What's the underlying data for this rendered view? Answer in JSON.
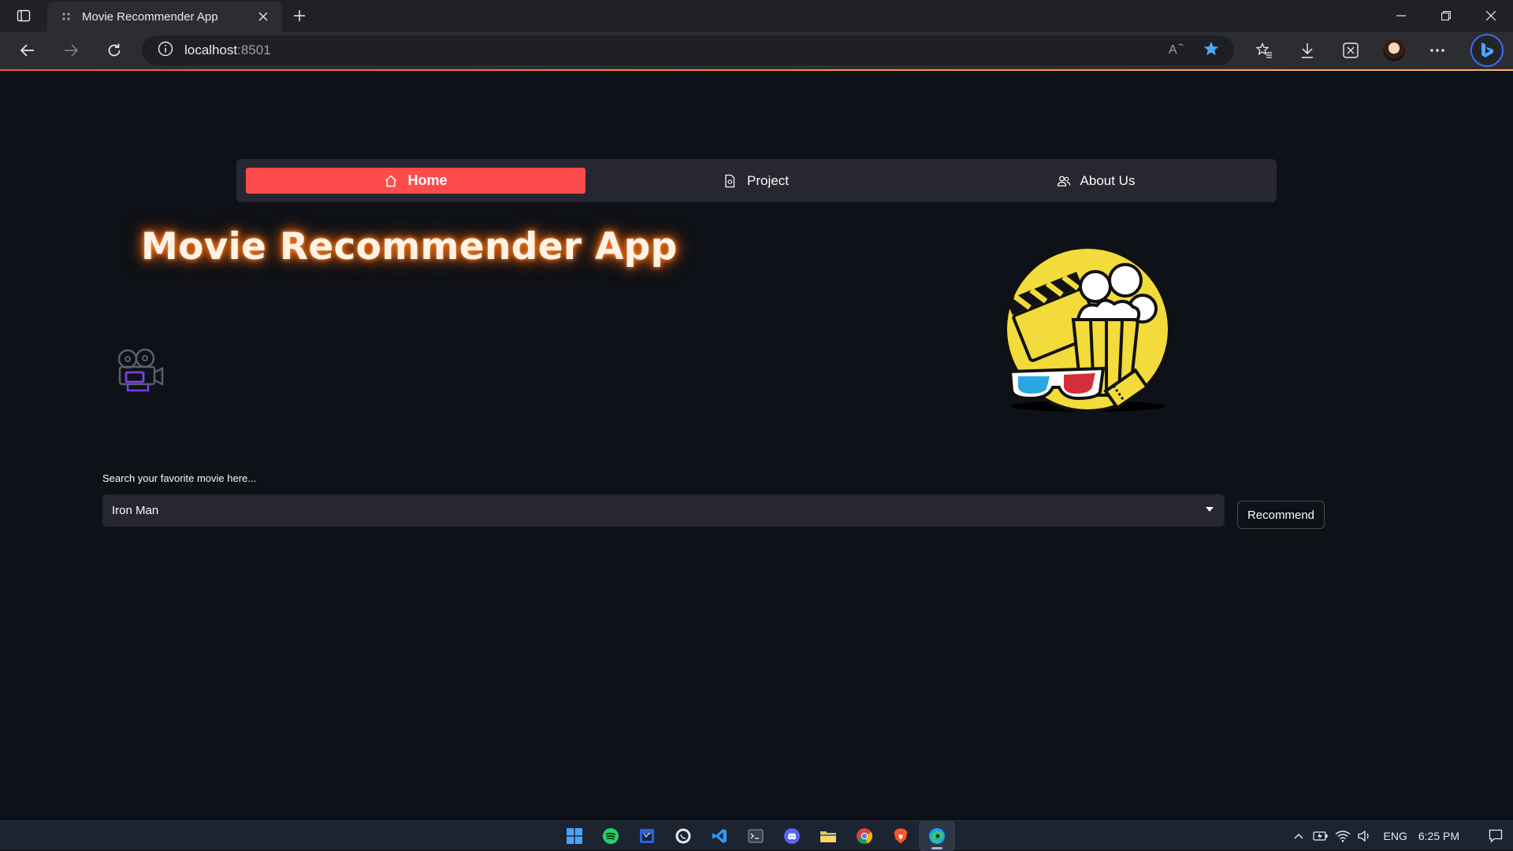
{
  "browser": {
    "tab_title": "Movie Recommender App",
    "url_host": "localhost",
    "url_port": ":8501"
  },
  "nav": {
    "items": [
      {
        "label": "Home",
        "icon": "house-icon",
        "active": true
      },
      {
        "label": "Project",
        "icon": "document-icon",
        "active": false
      },
      {
        "label": "About Us",
        "icon": "people-icon",
        "active": false
      }
    ],
    "active_color": "#ff4b4b"
  },
  "main": {
    "title": "Movie Recommender App",
    "search_label": "Search your favorite movie here...",
    "selected_movie": "Iron Man",
    "recommend_label": "Recommend"
  },
  "taskbar": {
    "apps": [
      "windows-start-icon",
      "spotify-icon",
      "media-player-icon",
      "whatsapp-icon",
      "vscode-icon",
      "terminal-icon",
      "discord-icon",
      "file-explorer-icon",
      "chrome-icon",
      "brave-icon",
      "edge-icon"
    ],
    "language": "ENG",
    "time": "6:25 PM"
  },
  "colors": {
    "app_bg": "#0e1117",
    "widget_bg": "#262730",
    "primary": "#ff4b4b",
    "title_glow": "#ff6a00"
  }
}
